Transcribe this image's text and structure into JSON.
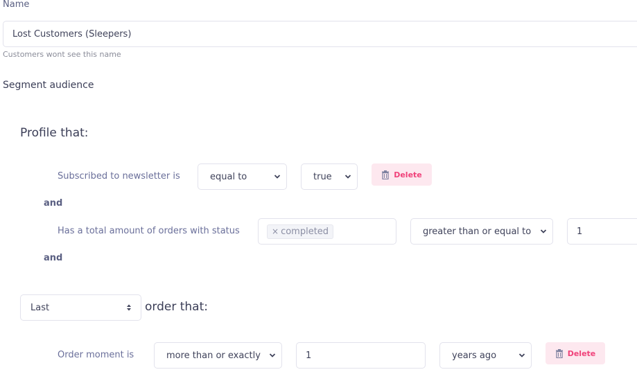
{
  "name_field": {
    "label": "Name",
    "value": "Lost Customers (Sleepers)",
    "hint": "Customers wont see this name"
  },
  "segment": {
    "title": "Segment audience",
    "profile_group": {
      "title": "Profile that:",
      "conditions": [
        {
          "label": "Subscribed to newsletter is",
          "operator": "equal to",
          "value": "true",
          "delete_label": "Delete"
        },
        {
          "label": "Has a total amount of orders with status",
          "tags": [
            "completed"
          ],
          "tag_remove_glyph": "×",
          "operator": "greater than or equal to",
          "value": "1"
        }
      ],
      "connectors": [
        "and",
        "and"
      ]
    },
    "order_group": {
      "selector": "Last",
      "title": "order that:",
      "conditions": [
        {
          "label": "Order moment is",
          "operator": "more than or exactly",
          "value": "1",
          "unit": "years ago",
          "delete_label": "Delete"
        }
      ]
    }
  },
  "colors": {
    "accent_delete": "#f0427a",
    "delete_bg": "#fde8ef",
    "label": "#6a6f9a"
  }
}
